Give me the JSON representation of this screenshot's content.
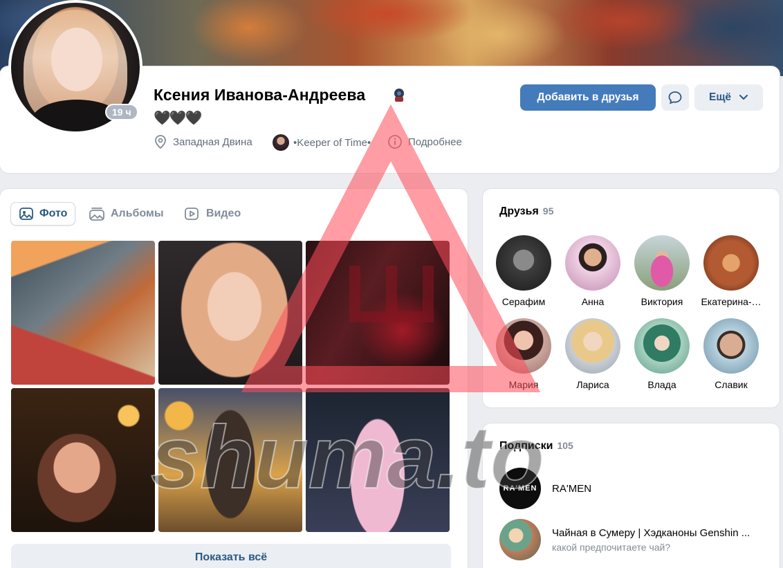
{
  "profile": {
    "name": "Ксения Иванова-Андреева",
    "status": "🖤🖤🖤",
    "online": "19 ч",
    "city": "Западная Двина",
    "group": "•Keeper of Time•",
    "more": "Подробнее",
    "add_friend": "Добавить в друзья",
    "more_menu": "Ещё"
  },
  "photos": {
    "tabs": [
      "Фото",
      "Альбомы",
      "Видео"
    ],
    "show_all": "Показать всё"
  },
  "friends": {
    "title": "Друзья",
    "count": "95",
    "items": [
      {
        "name": "Серафим",
        "color": "#3d3d3d"
      },
      {
        "name": "Анна",
        "color": "#d79fc1"
      },
      {
        "name": "Виктория",
        "color": "#9fb87a"
      },
      {
        "name": "Екатерина-…",
        "color": "#b35a32"
      },
      {
        "name": "Мария",
        "color": "#8b4a45"
      },
      {
        "name": "Лариса",
        "color": "#e4cf9e"
      },
      {
        "name": "Влада",
        "color": "#5f9b8d"
      },
      {
        "name": "Славик",
        "color": "#6b8fa3"
      }
    ]
  },
  "subscriptions": {
    "title": "Подписки",
    "count": "105",
    "items": [
      {
        "name": "RA'MEN",
        "desc": "",
        "avatar_text": "RA'MEN"
      },
      {
        "name": "Чайная в Сумеру | Хэдканоны Genshin ...",
        "desc": "какой предпочитаете чай?",
        "avatar_text": ""
      }
    ]
  },
  "watermark": "shuma.to"
}
